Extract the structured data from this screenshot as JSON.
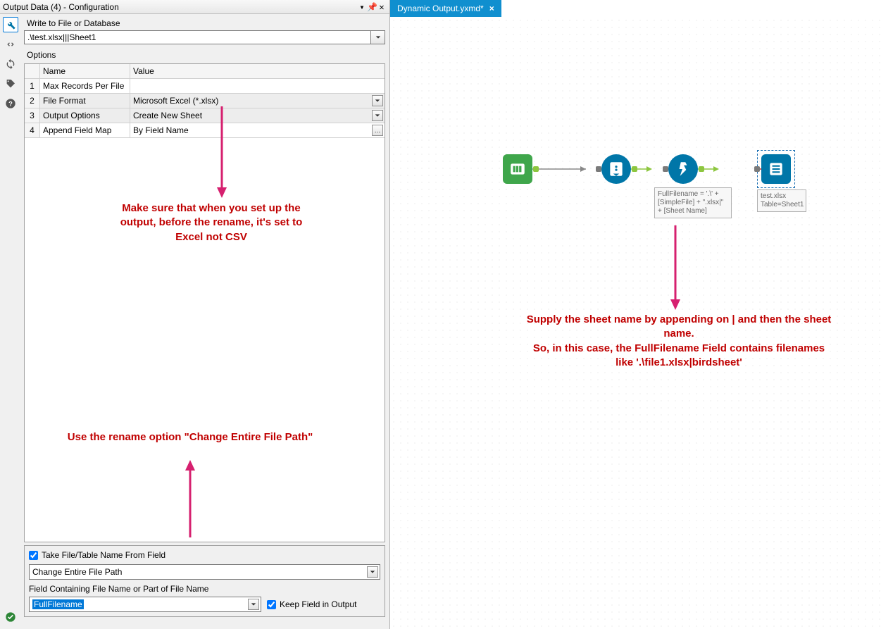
{
  "header": {
    "title": "Output Data (4) - Configuration"
  },
  "tab": {
    "label": "Dynamic Output.yxmd*"
  },
  "config": {
    "write_label": "Write to File or Database",
    "file_value": ".\\test.xlsx|||Sheet1",
    "options_label": "Options",
    "col_name": "Name",
    "col_value": "Value",
    "rows": [
      {
        "n": "1",
        "name": "Max Records Per File",
        "val": "",
        "type": "plain"
      },
      {
        "n": "2",
        "name": "File Format",
        "val": "Microsoft Excel (*.xlsx)",
        "type": "dd"
      },
      {
        "n": "3",
        "name": "Output Options",
        "val": "Create New Sheet",
        "type": "dd"
      },
      {
        "n": "4",
        "name": "Append Field Map",
        "val": "By Field Name",
        "type": "ell"
      }
    ]
  },
  "bottom": {
    "take_chk": "Take File/Table Name From Field",
    "path_option": "Change Entire File Path",
    "field_label": "Field Containing File Name or Part of File Name",
    "field_value": "FullFilename",
    "keep_chk": "Keep Field in Output"
  },
  "annotations": {
    "a1": "Make sure that when you set up the output, before the rename, it's set to Excel not CSV",
    "a2": "Use the rename option \"Change Entire File Path\"",
    "a3": "Supply the sheet name by appending on | and then the sheet name.\nSo, in this case, the FullFilename Field contains filenames like '.\\file1.xlsx|birdsheet'"
  },
  "canvas": {
    "formula_label": "FullFilename = '.\\' + [SimpleFile] + \".xlsx|\" + [Sheet Name]",
    "output_label": "test.xlsx\nTable=Sheet1"
  }
}
